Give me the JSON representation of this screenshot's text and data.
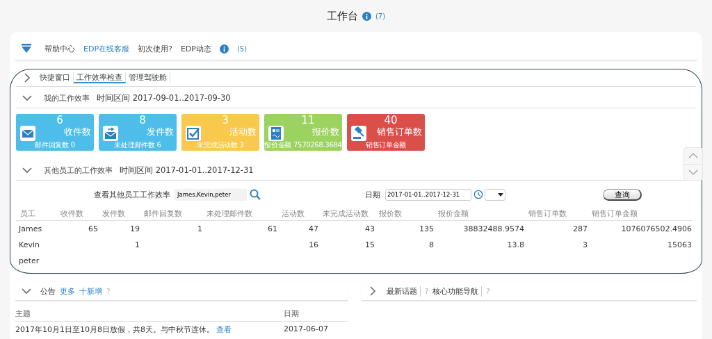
{
  "page": {
    "title": "工作台",
    "count": "(7)"
  },
  "help_bar": {
    "title": "帮助中心",
    "links": [
      {
        "label": "EDP在线客服",
        "kind": "link"
      },
      {
        "label": "初次使用?",
        "kind": "text"
      },
      {
        "label": "EDP动态",
        "kind": "text"
      }
    ],
    "count": "(5)"
  },
  "tabs": [
    {
      "label": "快捷窗口",
      "selected": false
    },
    {
      "label": "工作效率检查",
      "selected": true
    },
    {
      "label": "管理驾驶舱",
      "selected": false
    }
  ],
  "my_efficiency": {
    "title": "我的工作效率",
    "period": "时间区间 2017-09-01..2017-09-30",
    "tiles": [
      {
        "kind": "mail",
        "color": "#4fbde9",
        "value": "6",
        "label": "收件数",
        "detail": "邮件回复数 0"
      },
      {
        "kind": "send",
        "color": "#4fbde9",
        "value": "8",
        "label": "发件数",
        "detail": "未处理邮件数 6"
      },
      {
        "kind": "check",
        "color": "#f9c94e",
        "value": "3",
        "label": "活动数",
        "detail": "未完成活动数 3"
      },
      {
        "kind": "quote",
        "color": "#9cd25f",
        "value": "11",
        "label": "报价数",
        "detail": "报价金额 7570268.3684"
      },
      {
        "kind": "gavel",
        "color": "#db4f4b",
        "value": "40",
        "label": "销售订单数",
        "detail": "销售订单金额"
      }
    ]
  },
  "others_efficiency": {
    "title": "其他员工的工作效率",
    "period": "时间区间 2017-01-01..2017-12-31",
    "filter_label": "查看其他员工工作效率",
    "filter_value": "James,Kevin,peter",
    "date_label": "日期",
    "date_value": "2017-01-01..2017-12-31",
    "query_button": "查询",
    "table": {
      "columns": [
        "员工",
        "收件数",
        "发件数",
        "邮件回复数",
        "未处理邮件数",
        "活动数",
        "未完成活动数",
        "报价数",
        "报价金额",
        "销售订单数",
        "销售订单金额"
      ],
      "rows": [
        [
          "James",
          "65",
          "19",
          "1",
          "61",
          "47",
          "43",
          "135",
          "38832488.9574",
          "287",
          "1076076502.4906"
        ],
        [
          "Kevin",
          "",
          "1",
          "",
          "",
          "16",
          "15",
          "8",
          "13.8",
          "3",
          "15063"
        ],
        [
          "peter",
          "",
          "",
          "",
          "",
          "",
          "",
          "",
          "",
          "",
          ""
        ]
      ]
    }
  },
  "announcements": {
    "title": "公告",
    "more": "更多",
    "add": "十新增",
    "help": "?",
    "columns": [
      "主题",
      "日期"
    ],
    "rows": [
      {
        "subject": "2017年10月1日至10月8日放假，共8天。与中秋节连休。",
        "link": "查看",
        "date": "2017-06-07"
      }
    ]
  },
  "right_panel": {
    "tabs": [
      {
        "label": "最新话题",
        "help": "?"
      },
      {
        "label": "核心功能导航",
        "help": "?"
      }
    ]
  }
}
